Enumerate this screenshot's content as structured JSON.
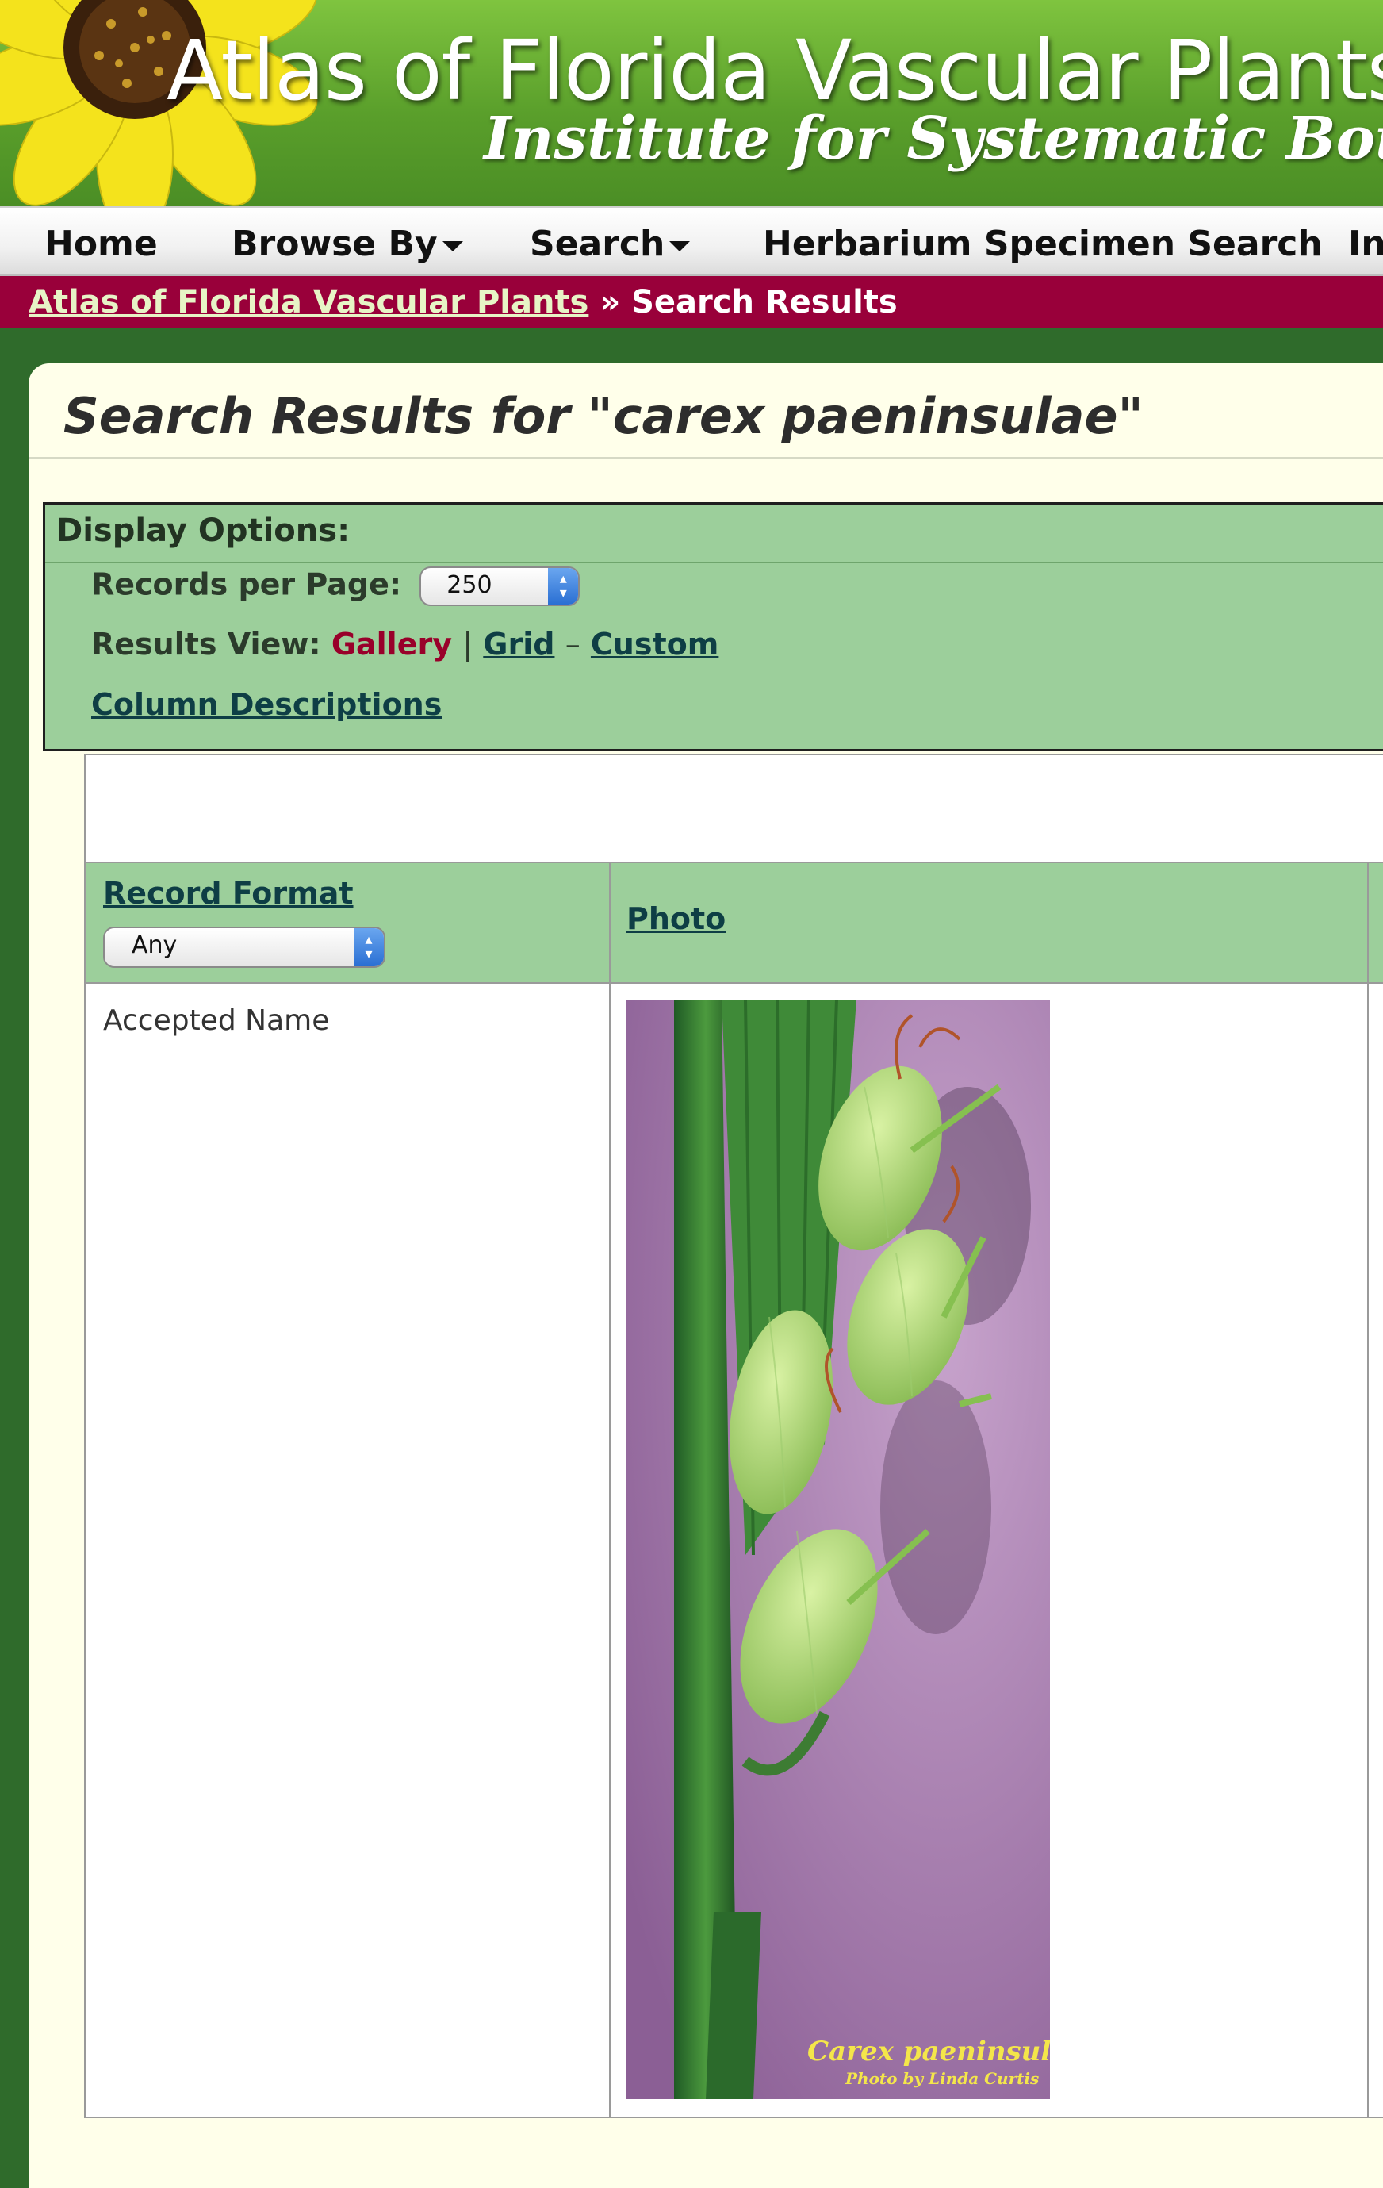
{
  "banner": {
    "title": "Atlas of Florida Vascular Plants",
    "subtitle": "Institute for Systematic Botany"
  },
  "nav": {
    "items": [
      {
        "label": "Home"
      },
      {
        "label": "Browse By"
      },
      {
        "label": "Search"
      },
      {
        "label": "Herbarium Specimen Search"
      },
      {
        "label": "In"
      }
    ]
  },
  "breadcrumb": {
    "root": "Atlas of Florida Vascular Plants",
    "separator": "»",
    "current": "Search Results"
  },
  "page": {
    "title": "Search Results for \"carex paeninsulae\""
  },
  "display_options": {
    "heading": "Display Options:",
    "records_label": "Records per Page:",
    "records_value": "250",
    "view_label": "Results View:",
    "view_gallery": "Gallery",
    "view_sep1": "|",
    "view_grid": "Grid",
    "view_sep2": "–",
    "view_custom": "Custom",
    "column_descriptions": "Column Descriptions"
  },
  "results": {
    "columns": [
      {
        "label": "Record Format",
        "filter_value": "Any"
      },
      {
        "label": "Photo"
      }
    ],
    "rows": [
      {
        "record_format": "Accepted Name",
        "photo_caption": "Carex paeninsulae",
        "photo_credit": "Photo by Linda Curtis"
      }
    ]
  },
  "colors": {
    "banner_green": "#5a9f2b",
    "breadcrumb_bg": "#99003a",
    "options_bg": "#9ccf9b",
    "panel_bg": "#ffffea",
    "link": "#0e3e45",
    "active_link": "#99002a"
  }
}
